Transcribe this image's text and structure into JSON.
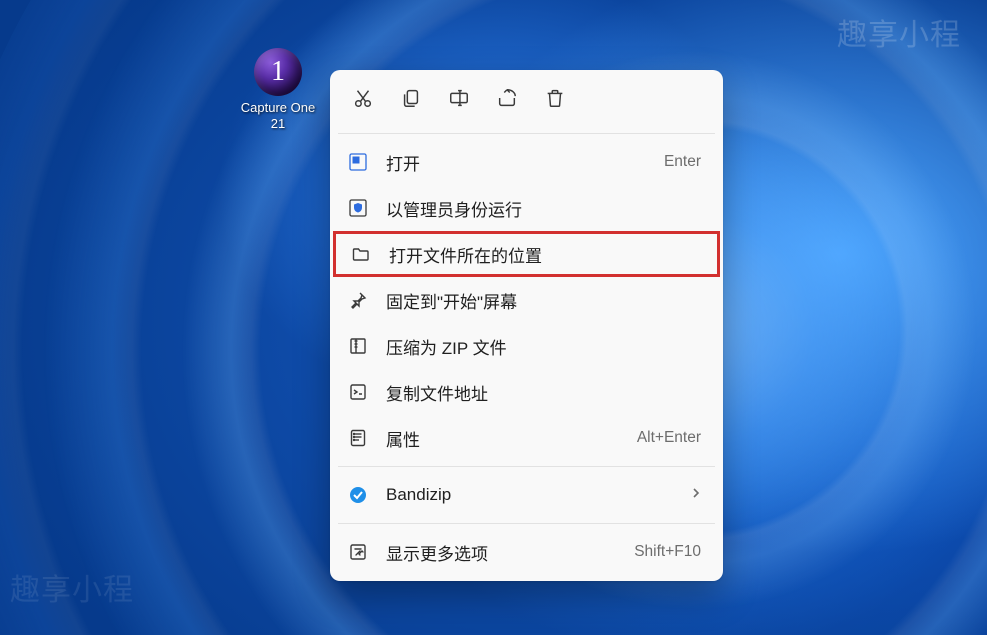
{
  "watermark": "趣享小程",
  "desktop": {
    "icon_glyph": "1",
    "icon_label": "Capture One\n21"
  },
  "toolbar": {
    "cut": "cut-icon",
    "copy": "copy-icon",
    "rename": "rename-icon",
    "share": "share-icon",
    "delete": "delete-icon"
  },
  "menu": {
    "open": {
      "label": "打开",
      "shortcut": "Enter"
    },
    "run_admin": {
      "label": "以管理员身份运行"
    },
    "open_location": {
      "label": "打开文件所在的位置"
    },
    "pin_start": {
      "label": "固定到\"开始\"屏幕"
    },
    "compress_zip": {
      "label": "压缩为 ZIP 文件"
    },
    "copy_path": {
      "label": "复制文件地址"
    },
    "properties": {
      "label": "属性",
      "shortcut": "Alt+Enter"
    },
    "bandizip": {
      "label": "Bandizip"
    },
    "show_more": {
      "label": "显示更多选项",
      "shortcut": "Shift+F10"
    }
  }
}
